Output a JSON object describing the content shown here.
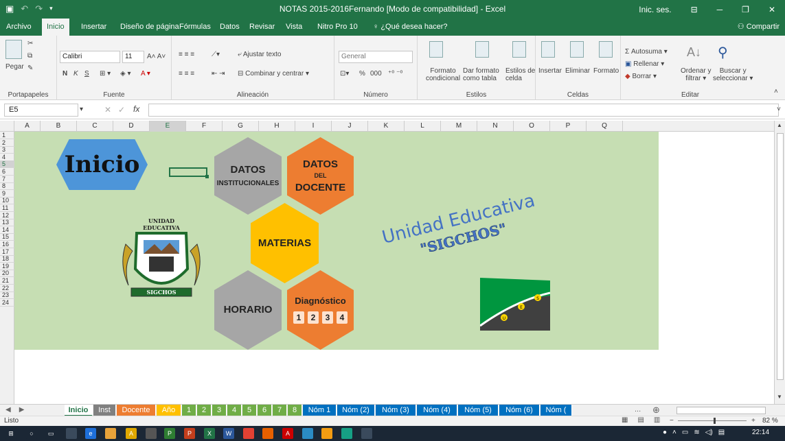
{
  "titlebar": {
    "title": "NOTAS 2015-2016Fernando  [Modo de compatibilidad]  -  Excel",
    "signin": "Inic. ses.",
    "qa_icons": [
      "save-icon",
      "undo-icon",
      "redo-icon",
      "customize-icon"
    ]
  },
  "menu": {
    "tabs": [
      "Archivo",
      "Inicio",
      "Insertar",
      "Diseño de página",
      "Fórmulas",
      "Datos",
      "Revisar",
      "Vista",
      "Nitro Pro 10"
    ],
    "tellme": "¿Qué desea hacer?",
    "share": "Compartir"
  },
  "ribbon": {
    "clipboard": {
      "paste": "Pegar",
      "group": "Portapapeles"
    },
    "font": {
      "name": "Calibri",
      "size": "11",
      "bold": "N",
      "italic": "K",
      "underline": "S",
      "group": "Fuente"
    },
    "align": {
      "wrap": "Ajustar texto",
      "merge": "Combinar y centrar",
      "group": "Alineación"
    },
    "number": {
      "format": "General",
      "percent": "%",
      "thousands": "000",
      "group": "Número"
    },
    "styles": {
      "conditional1": "Formato",
      "conditional2": "condicional",
      "table1": "Dar formato",
      "table2": "como tabla",
      "cell1": "Estilos de",
      "cell2": "celda",
      "group": "Estilos"
    },
    "cells": {
      "insert": "Insertar",
      "delete": "Eliminar",
      "format": "Formato",
      "group": "Celdas"
    },
    "edit": {
      "autosum": "Autosuma",
      "fill": "Rellenar",
      "clear": "Borrar",
      "sort1": "Ordenar y",
      "sort2": "filtrar",
      "find1": "Buscar y",
      "find2": "seleccionar",
      "group": "Editar"
    }
  },
  "formula": {
    "namebox": "E5",
    "fx": "fx",
    "value": ""
  },
  "columns": [
    "A",
    "B",
    "C",
    "D",
    "E",
    "F",
    "G",
    "H",
    "I",
    "J",
    "K",
    "L",
    "M",
    "N",
    "O",
    "P",
    "Q"
  ],
  "selected_col": "E",
  "rows": [
    "1",
    "2",
    "3",
    "4",
    "5",
    "6",
    "7",
    "8",
    "9",
    "10",
    "11",
    "12",
    "13",
    "14",
    "15",
    "16",
    "17",
    "18",
    "19",
    "20",
    "21",
    "22",
    "23",
    "24"
  ],
  "selected_row": "5",
  "sheet": {
    "inicio": "Inicio",
    "datos_inst": {
      "l1": "DATOS",
      "l2": "INSTITUCIONALES",
      "color": "#a6a6a6"
    },
    "datos_doc": {
      "l1": "DATOS",
      "l2": "DEL",
      "l3": "DOCENTE",
      "color": "#ed7d31"
    },
    "materias": {
      "label": "MATERIAS",
      "color": "#ffc000"
    },
    "horario": {
      "label": "HORARIO",
      "color": "#a6a6a6"
    },
    "diagnostico": {
      "label": "Diagnóstico",
      "numbers": [
        "1",
        "2",
        "3",
        "4"
      ],
      "color": "#ed7d31"
    },
    "crest": {
      "top1": "UNIDAD",
      "top2": "EDUCATIVA",
      "ribbon": "SIGCHOS"
    },
    "wordart": {
      "line1": "Unidad Educativa",
      "line2": "\"SIGCHOS\"",
      "color": "#4472c4"
    },
    "flag": {
      "letters": [
        "U",
        "E",
        "S"
      ],
      "green": "#00963f",
      "dark": "#404040"
    }
  },
  "sheet_tabs": [
    {
      "label": "Inicio",
      "color": "#ffffff",
      "active": true
    },
    {
      "label": "Inst",
      "color": "#808080"
    },
    {
      "label": "Docente",
      "color": "#ed7d31"
    },
    {
      "label": "Año",
      "color": "#ffc000"
    },
    {
      "label": "1",
      "color": "#70ad47"
    },
    {
      "label": "2",
      "color": "#70ad47"
    },
    {
      "label": "3",
      "color": "#70ad47"
    },
    {
      "label": "4",
      "color": "#70ad47"
    },
    {
      "label": "5",
      "color": "#70ad47"
    },
    {
      "label": "6",
      "color": "#70ad47"
    },
    {
      "label": "7",
      "color": "#70ad47"
    },
    {
      "label": "8",
      "color": "#70ad47"
    },
    {
      "label": "Nóm 1",
      "color": "#0070c0"
    },
    {
      "label": "Nóm (2)",
      "color": "#0070c0"
    },
    {
      "label": "Nóm (3)",
      "color": "#0070c0"
    },
    {
      "label": "Nóm (4)",
      "color": "#0070c0"
    },
    {
      "label": "Nóm (5)",
      "color": "#0070c0"
    },
    {
      "label": "Nóm (6)",
      "color": "#0070c0"
    },
    {
      "label": "Nóm (",
      "color": "#0070c0"
    }
  ],
  "tabbar": {
    "more": "...",
    "add": "⊕"
  },
  "status": {
    "ready": "Listo",
    "zoom": "82 %"
  },
  "taskbar": {
    "time": "22:14",
    "apps": [
      {
        "name": "windows-start-icon",
        "c": "#1b2735",
        "t": "⊞"
      },
      {
        "name": "cortana-icon",
        "c": "#1b2735",
        "t": "○"
      },
      {
        "name": "task-view-icon",
        "c": "#1b2735",
        "t": "▭"
      },
      {
        "name": "keyboard-icon",
        "c": "#3a4a5c",
        "t": ""
      },
      {
        "name": "edge-icon",
        "c": "#1e6fd9",
        "t": "e"
      },
      {
        "name": "explorer-icon",
        "c": "#e8a33a",
        "t": ""
      },
      {
        "name": "app-icon",
        "c": "#e0a800",
        "t": "A"
      },
      {
        "name": "app-icon",
        "c": "#555",
        "t": ""
      },
      {
        "name": "project-icon",
        "c": "#2e7d32",
        "t": "P"
      },
      {
        "name": "powerpoint-icon",
        "c": "#c43e1c",
        "t": "P"
      },
      {
        "name": "excel-icon",
        "c": "#217346",
        "t": "X"
      },
      {
        "name": "word-icon",
        "c": "#2b579a",
        "t": "W"
      },
      {
        "name": "chrome-icon",
        "c": "#e34133",
        "t": ""
      },
      {
        "name": "firefox-icon",
        "c": "#e66000",
        "t": ""
      },
      {
        "name": "acrobat-icon",
        "c": "#c00",
        "t": "A"
      },
      {
        "name": "app-icon",
        "c": "#2b8cc4",
        "t": ""
      },
      {
        "name": "vlc-icon",
        "c": "#f39c12",
        "t": ""
      },
      {
        "name": "app-icon",
        "c": "#16a085",
        "t": ""
      },
      {
        "name": "photos-icon",
        "c": "#3a4a5c",
        "t": ""
      }
    ]
  }
}
